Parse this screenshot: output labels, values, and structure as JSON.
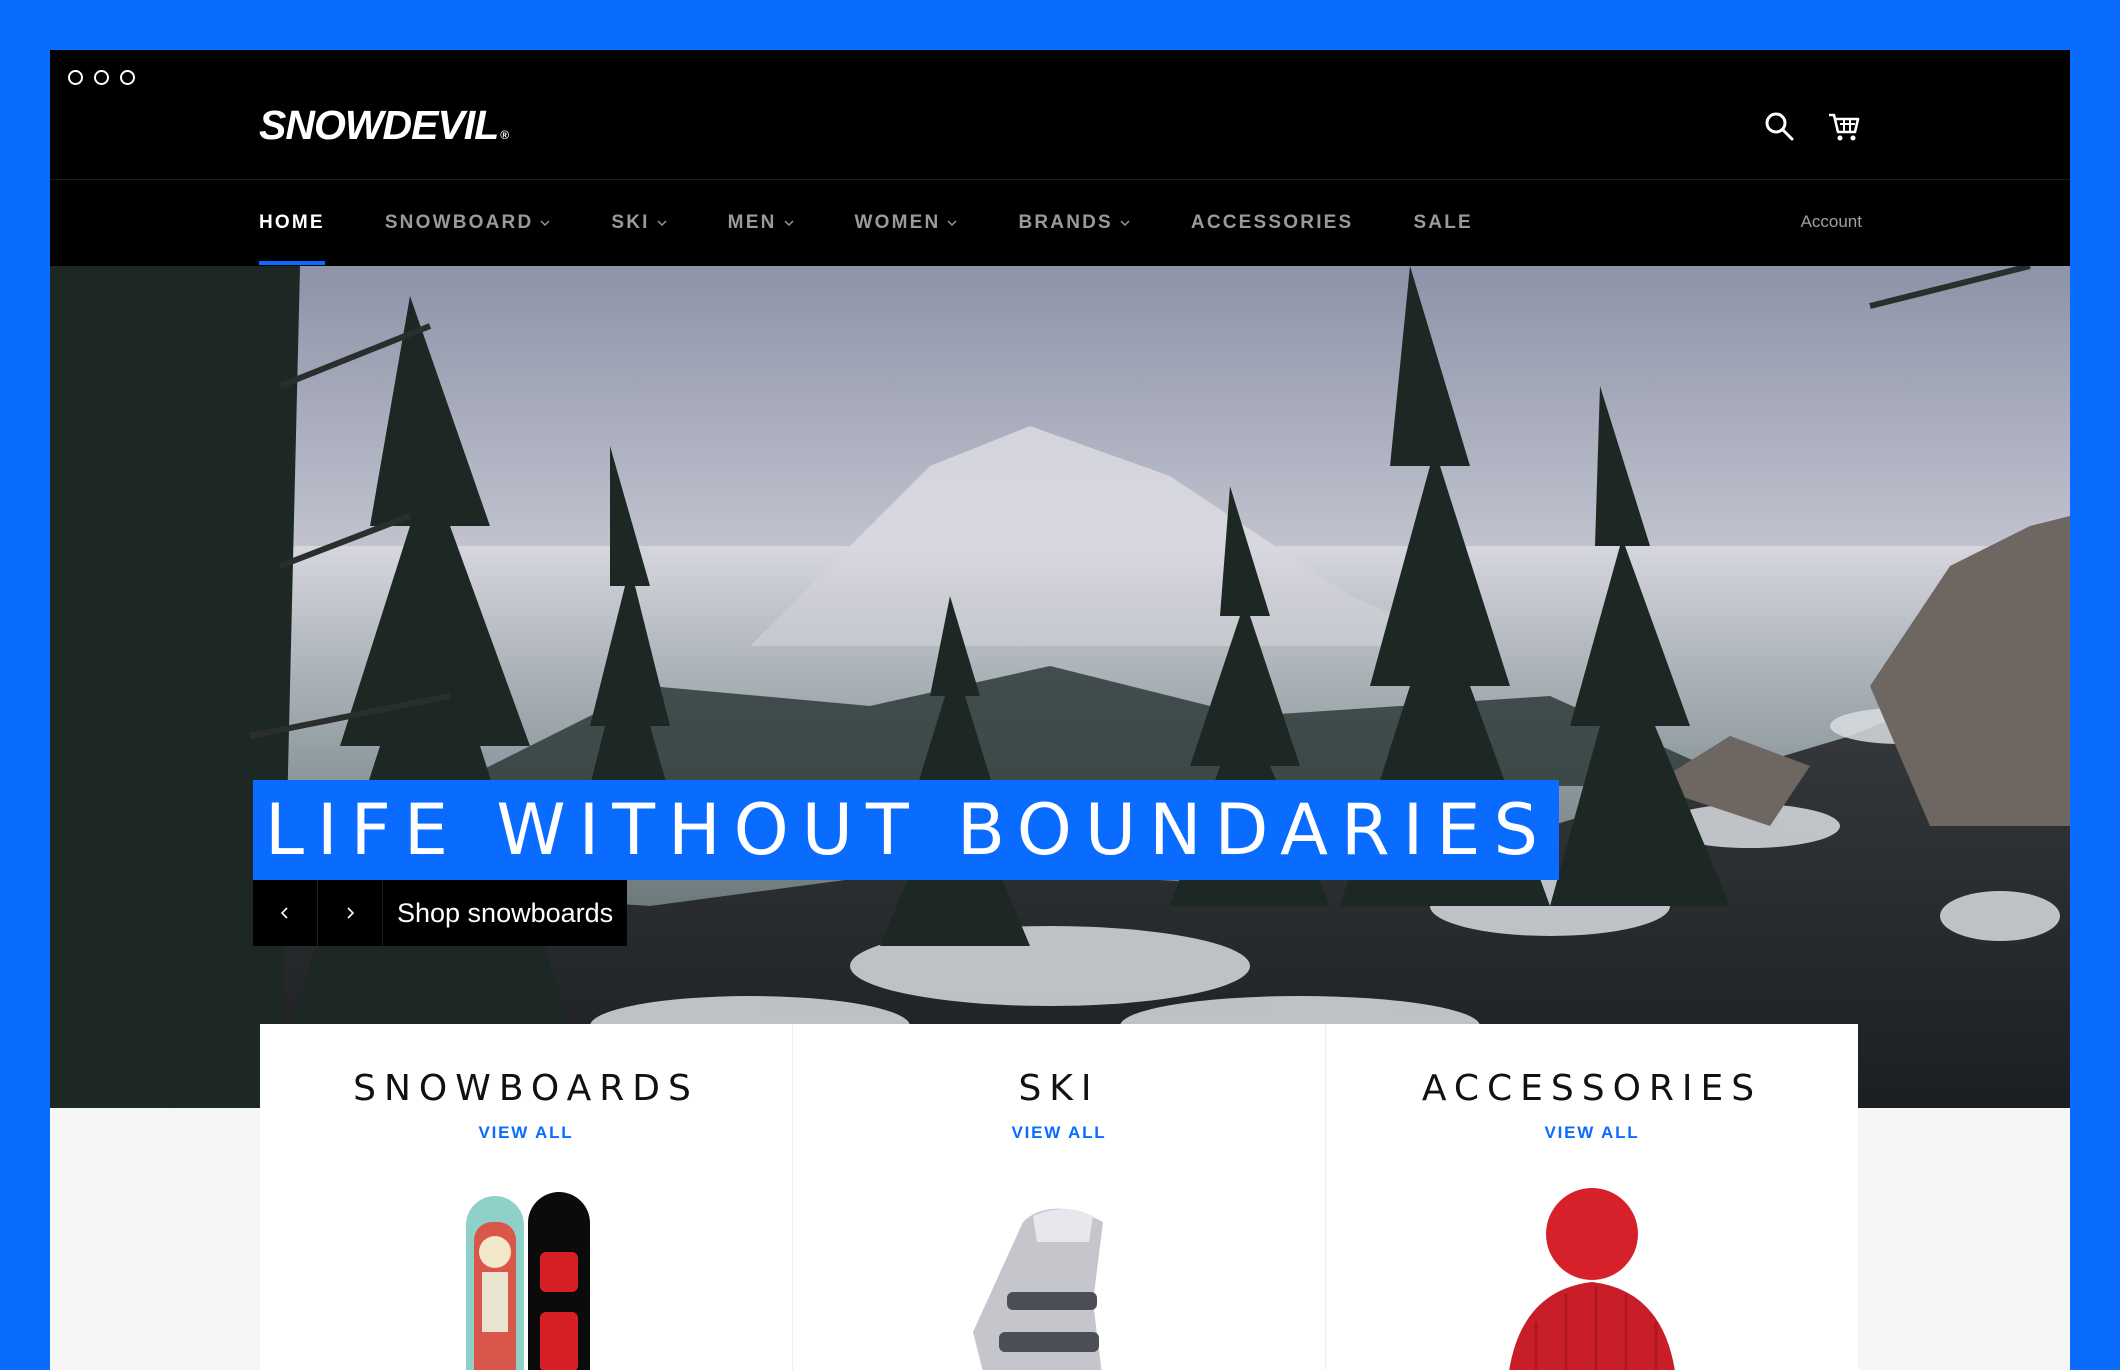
{
  "brand": {
    "name": "SNOWDEVIL",
    "registered_mark": "®"
  },
  "header": {
    "icons": [
      "search-icon",
      "cart-icon"
    ]
  },
  "nav": {
    "items": [
      {
        "label": "HOME",
        "active": true,
        "has_dropdown": false
      },
      {
        "label": "SNOWBOARD",
        "active": false,
        "has_dropdown": true
      },
      {
        "label": "SKI",
        "active": false,
        "has_dropdown": true
      },
      {
        "label": "MEN",
        "active": false,
        "has_dropdown": true
      },
      {
        "label": "WOMEN",
        "active": false,
        "has_dropdown": true
      },
      {
        "label": "BRANDS",
        "active": false,
        "has_dropdown": true
      },
      {
        "label": "ACCESSORIES",
        "active": false,
        "has_dropdown": false
      },
      {
        "label": "SALE",
        "active": false,
        "has_dropdown": false
      }
    ],
    "account_label": "Account"
  },
  "hero": {
    "title": "LIFE WITHOUT BOUNDARIES",
    "cta_label": "Shop snowboards",
    "prev_icon": "chevron-left-icon",
    "next_icon": "chevron-right-icon"
  },
  "collections": [
    {
      "title": "SNOWBOARDS",
      "link_label": "VIEW ALL"
    },
    {
      "title": "SKI",
      "link_label": "VIEW ALL"
    },
    {
      "title": "ACCESSORIES",
      "link_label": "VIEW ALL"
    }
  ],
  "colors": {
    "accent": "#0a6cff",
    "header_bg": "#000000",
    "nav_inactive": "#9a9a9a"
  }
}
